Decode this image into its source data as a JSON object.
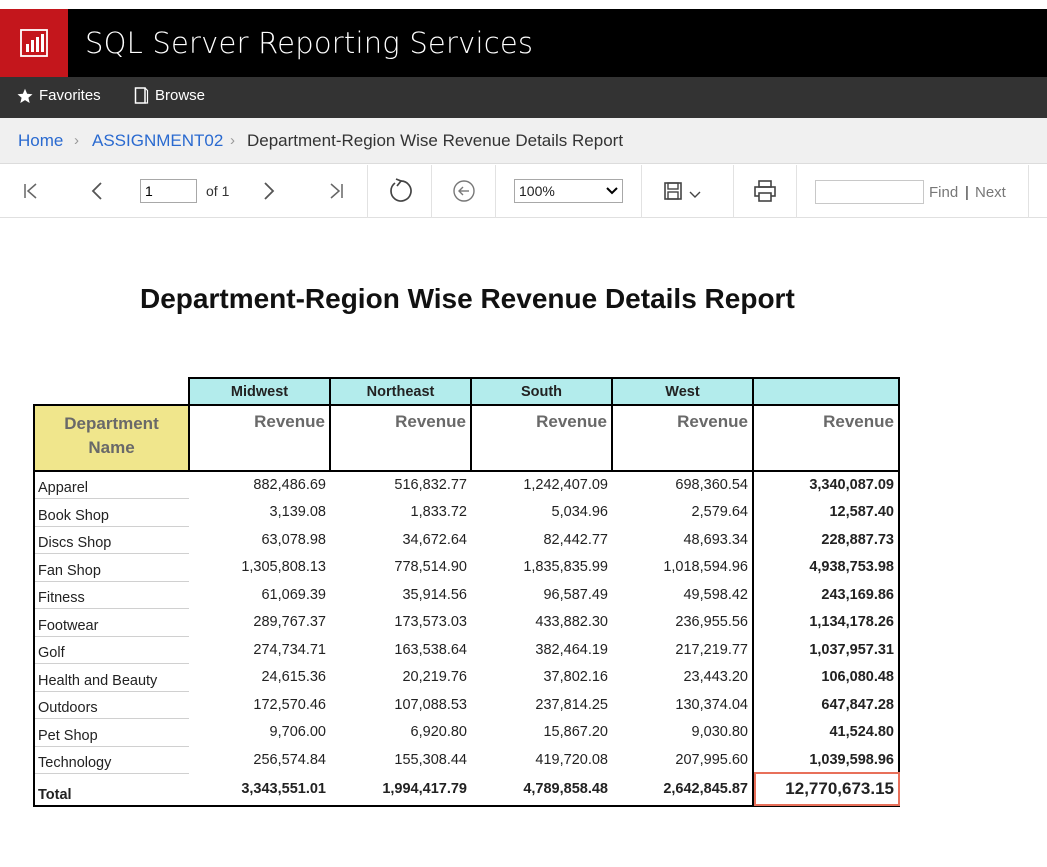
{
  "app": {
    "title": "SQL Server Reporting Services",
    "logo_icon": "report-chart-icon",
    "brand_color": "#c4161c"
  },
  "nav": {
    "favorites_label": "Favorites",
    "browse_label": "Browse"
  },
  "breadcrumb": {
    "home": "Home",
    "folder": "ASSIGNMENT02",
    "current": "Department-Region Wise Revenue Details Report"
  },
  "toolbar": {
    "page_value": "1",
    "of_label": "of 1",
    "zoom_value": "100%",
    "find_label": "Find",
    "separator": "|",
    "next_label": "Next"
  },
  "report": {
    "title": "Department-Region Wise Revenue Details Report",
    "regions": [
      "Midwest",
      "Northeast",
      "South",
      "West"
    ],
    "dept_header_line1": "Department",
    "dept_header_line2": "Name",
    "revenue_label": "Revenue",
    "rows": [
      {
        "dept": "Apparel",
        "values": [
          "882,486.69",
          "516,832.77",
          "1,242,407.09",
          "698,360.54"
        ],
        "total": "3,340,087.09"
      },
      {
        "dept": "Book Shop",
        "values": [
          "3,139.08",
          "1,833.72",
          "5,034.96",
          "2,579.64"
        ],
        "total": "12,587.40"
      },
      {
        "dept": "Discs Shop",
        "values": [
          "63,078.98",
          "34,672.64",
          "82,442.77",
          "48,693.34"
        ],
        "total": "228,887.73"
      },
      {
        "dept": "Fan Shop",
        "values": [
          "1,305,808.13",
          "778,514.90",
          "1,835,835.99",
          "1,018,594.96"
        ],
        "total": "4,938,753.98"
      },
      {
        "dept": "Fitness",
        "values": [
          "61,069.39",
          "35,914.56",
          "96,587.49",
          "49,598.42"
        ],
        "total": "243,169.86"
      },
      {
        "dept": "Footwear",
        "values": [
          "289,767.37",
          "173,573.03",
          "433,882.30",
          "236,955.56"
        ],
        "total": "1,134,178.26"
      },
      {
        "dept": "Golf",
        "values": [
          "274,734.71",
          "163,538.64",
          "382,464.19",
          "217,219.77"
        ],
        "total": "1,037,957.31"
      },
      {
        "dept": "Health and Beauty",
        "values": [
          "24,615.36",
          "20,219.76",
          "37,802.16",
          "23,443.20"
        ],
        "total": "106,080.48"
      },
      {
        "dept": "Outdoors",
        "values": [
          "172,570.46",
          "107,088.53",
          "237,814.25",
          "130,374.04"
        ],
        "total": "647,847.28"
      },
      {
        "dept": "Pet Shop",
        "values": [
          "9,706.00",
          "6,920.80",
          "15,867.20",
          "9,030.80"
        ],
        "total": "41,524.80"
      },
      {
        "dept": "Technology",
        "values": [
          "256,574.84",
          "155,308.44",
          "419,720.08",
          "207,995.60"
        ],
        "total": "1,039,598.96"
      }
    ],
    "total_row": {
      "label": "Total",
      "values": [
        "3,343,551.01",
        "1,994,417.79",
        "4,789,858.48",
        "2,642,845.87"
      ],
      "grand_total": "12,770,673.15"
    },
    "highlight_color": "#e8705a"
  }
}
